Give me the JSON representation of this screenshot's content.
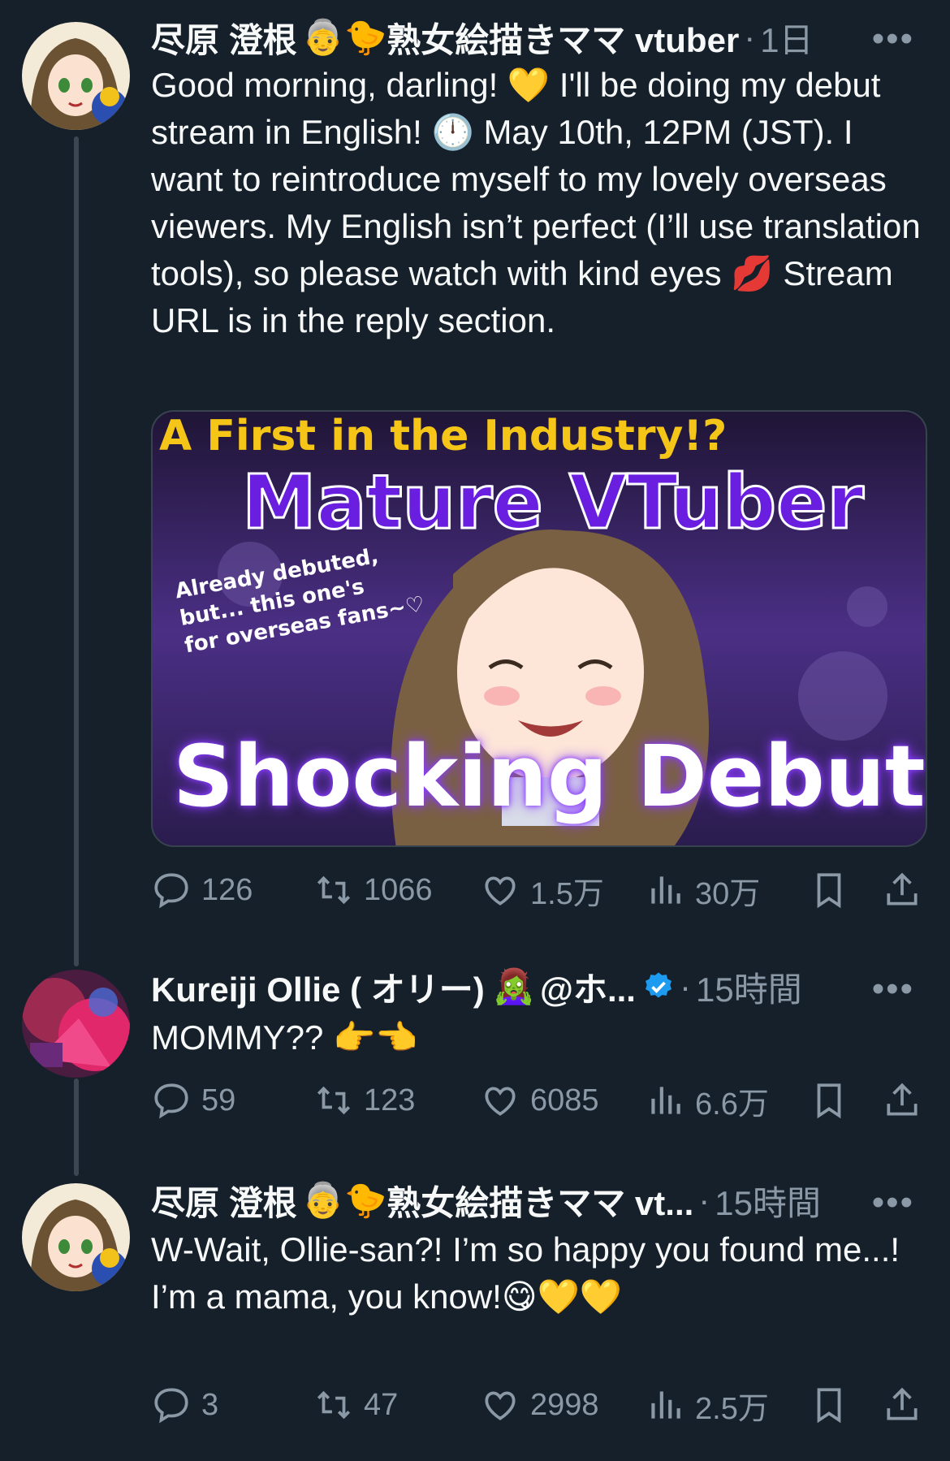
{
  "tweets": [
    {
      "author": "尽原 澄根",
      "author_badges": "👵🐤",
      "author_suffix": "熟女絵描きママ vtuber",
      "handle": "",
      "time": "1日",
      "text": "Good morning, darling! 💛 I'll be doing my debut stream in English! 🕛 May 10th, 12PM (JST). I want to reintroduce myself to my lovely overseas viewers. My English isn’t perfect (I’ll use translation tools), so please watch with kind eyes 💋 Stream URL is in the reply section.",
      "media": {
        "headline_1": "A First in the Industry!?",
        "headline_2": "Mature VTuber",
        "side_text": "Already debuted,\nbut... this one's\nfor overseas fans~♡",
        "headline_3": "Shocking Debut"
      },
      "stats": {
        "replies": "126",
        "retweets": "1066",
        "likes": "1.5万",
        "views": "30万"
      }
    },
    {
      "author": "Kureiji Ollie ( オリー)",
      "author_badges": "🧟‍♀️",
      "handle": "@ホ...",
      "verified": true,
      "time": "15時間",
      "text": "MOMMY?? 👉👈",
      "stats": {
        "replies": "59",
        "retweets": "123",
        "likes": "6085",
        "views": "6.6万"
      }
    },
    {
      "author": "尽原 澄根",
      "author_badges": "👵🐤",
      "author_suffix": "熟女絵描きママ vt...",
      "handle": "",
      "time": "15時間",
      "text": "W-Wait, Ollie-san?! I’m so happy you found me...!\nI’m a mama, you know!😋💛💛",
      "stats": {
        "replies": "3",
        "retweets": "47",
        "likes": "2998",
        "views": "2.5万"
      }
    }
  ],
  "colors": {
    "background": "#15202b",
    "muted": "#8b98a5",
    "verified": "#1d9bf0",
    "media_purple": "#6a1fe0"
  },
  "icons": [
    "reply-icon",
    "retweet-icon",
    "like-icon",
    "views-icon",
    "bookmark-icon",
    "share-icon",
    "more-icon",
    "verified-icon"
  ]
}
